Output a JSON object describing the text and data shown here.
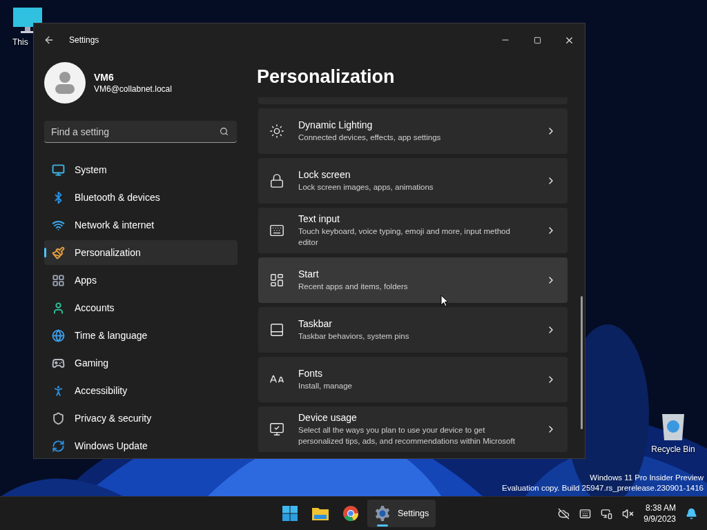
{
  "desktop": {
    "icons": [
      {
        "kind": "pc",
        "label": "This"
      },
      {
        "kind": "bin",
        "label": "Recycle Bin"
      }
    ],
    "build_info": [
      "Windows 11 Pro Insider Preview",
      "Evaluation copy. Build 25947.rs_prerelease.230901-1416"
    ]
  },
  "window": {
    "title": "Settings"
  },
  "user": {
    "name": "VM6",
    "email": "VM6@collabnet.local"
  },
  "search": {
    "placeholder": "Find a setting"
  },
  "nav": [
    {
      "kind": "system",
      "label": "System",
      "selected": false
    },
    {
      "kind": "bluetooth",
      "label": "Bluetooth & devices",
      "selected": false
    },
    {
      "kind": "network",
      "label": "Network & internet",
      "selected": false
    },
    {
      "kind": "personalization",
      "label": "Personalization",
      "selected": true
    },
    {
      "kind": "apps",
      "label": "Apps",
      "selected": false
    },
    {
      "kind": "accounts",
      "label": "Accounts",
      "selected": false
    },
    {
      "kind": "time",
      "label": "Time & language",
      "selected": false
    },
    {
      "kind": "gaming",
      "label": "Gaming",
      "selected": false
    },
    {
      "kind": "accessibility",
      "label": "Accessibility",
      "selected": false
    },
    {
      "kind": "privacy",
      "label": "Privacy & security",
      "selected": false
    },
    {
      "kind": "update",
      "label": "Windows Update",
      "selected": false
    }
  ],
  "page_title": "Personalization",
  "cards": [
    {
      "kind": "lighting",
      "title": "Dynamic Lighting",
      "subtitle": "Connected devices, effects, app settings",
      "hovered": false
    },
    {
      "kind": "lock",
      "title": "Lock screen",
      "subtitle": "Lock screen images, apps, animations",
      "hovered": false
    },
    {
      "kind": "keyboard",
      "title": "Text input",
      "subtitle": "Touch keyboard, voice typing, emoji and more, input method editor",
      "hovered": false
    },
    {
      "kind": "start",
      "title": "Start",
      "subtitle": "Recent apps and items, folders",
      "hovered": true
    },
    {
      "kind": "taskbar",
      "title": "Taskbar",
      "subtitle": "Taskbar behaviors, system pins",
      "hovered": false
    },
    {
      "kind": "fonts",
      "title": "Fonts",
      "subtitle": "Install, manage",
      "hovered": false
    },
    {
      "kind": "device",
      "title": "Device usage",
      "subtitle": "Select all the ways you plan to use your device to get personalized tips, ads, and recommendations within Microsoft",
      "hovered": false
    }
  ],
  "taskbar": {
    "apps": [
      {
        "kind": "start",
        "selected": false
      },
      {
        "kind": "explorer",
        "selected": false
      },
      {
        "kind": "chrome",
        "selected": false
      },
      {
        "kind": "settings",
        "label": "Settings",
        "selected": true
      }
    ],
    "tray": [
      {
        "kind": "cloud"
      },
      {
        "kind": "keyboard"
      },
      {
        "kind": "network"
      },
      {
        "kind": "volume"
      }
    ],
    "time": "8:38 AM",
    "date": "9/9/2023"
  }
}
